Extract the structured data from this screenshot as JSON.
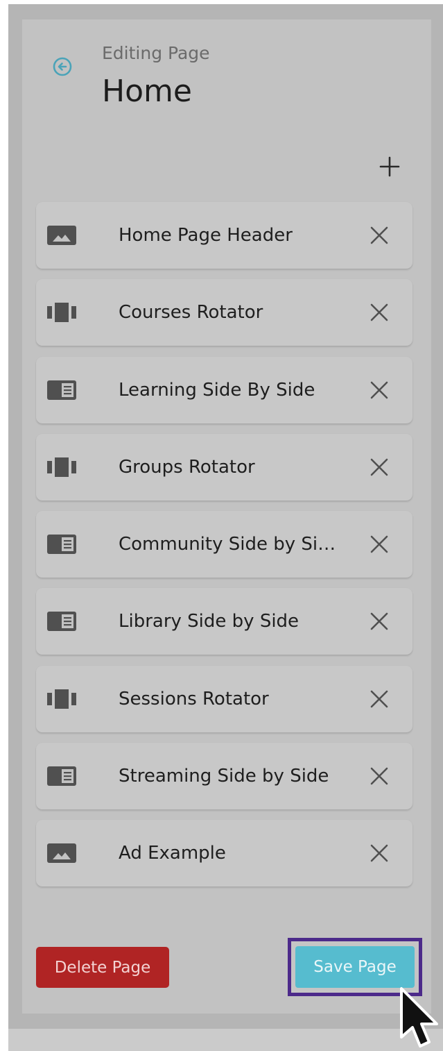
{
  "header": {
    "subtitle": "Editing Page",
    "title": "Home",
    "back_icon": "circle-arrow-left-icon",
    "add_icon": "plus-icon"
  },
  "components": [
    {
      "label": "Home Page Header",
      "icon": "image-icon"
    },
    {
      "label": "Courses Rotator",
      "icon": "carousel-icon"
    },
    {
      "label": "Learning Side By Side",
      "icon": "side-by-side-icon"
    },
    {
      "label": "Groups Rotator",
      "icon": "carousel-icon"
    },
    {
      "label": "Community Side by Si…",
      "icon": "side-by-side-icon"
    },
    {
      "label": "Library Side by Side",
      "icon": "side-by-side-icon"
    },
    {
      "label": "Sessions Rotator",
      "icon": "carousel-icon"
    },
    {
      "label": "Streaming Side by Side",
      "icon": "side-by-side-icon"
    },
    {
      "label": "Ad Example",
      "icon": "image-icon"
    }
  ],
  "actions": {
    "delete_label": "Delete Page",
    "save_label": "Save Page"
  },
  "colors": {
    "accent": "#56bccf",
    "danger": "#b02424",
    "highlight": "#4c2a8a",
    "back_icon": "#4aa3b8"
  }
}
